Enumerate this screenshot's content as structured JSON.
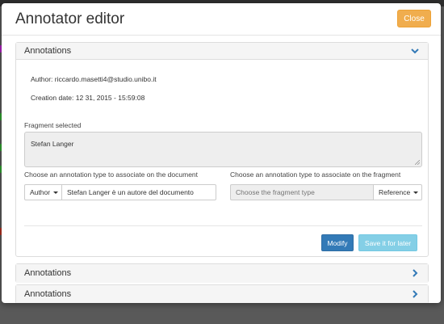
{
  "modal": {
    "title": "Annotator editor",
    "close_label": "Close"
  },
  "panels": [
    {
      "title": "Annotations",
      "expanded": true
    },
    {
      "title": "Annotations",
      "expanded": false
    },
    {
      "title": "Annotations",
      "expanded": false
    }
  ],
  "annotation": {
    "author_line": "Author: riccardo.masetti4@studio.unibo.it",
    "date_line": "Creation date: 12 31, 2015 - 15:59:08",
    "fragment_label": "Fragment selected",
    "fragment_text": "Stefan Langer",
    "doc_type_label": "Choose an annotation type to associate on the document",
    "doc_type_selected": "Author",
    "doc_value": "Stefan Langer è un autore del documento",
    "frag_type_label": "Choose an annotation type to associate on the fragment",
    "frag_type_placeholder": "Choose the fragment type",
    "frag_type_selected": "Reference",
    "modify_label": "Modify",
    "save_label": "Save it for later"
  },
  "colors": {
    "primary": "#337ab7",
    "info": "#5bc0de",
    "warning": "#f0ad4e",
    "chevron": "#337ab7"
  }
}
